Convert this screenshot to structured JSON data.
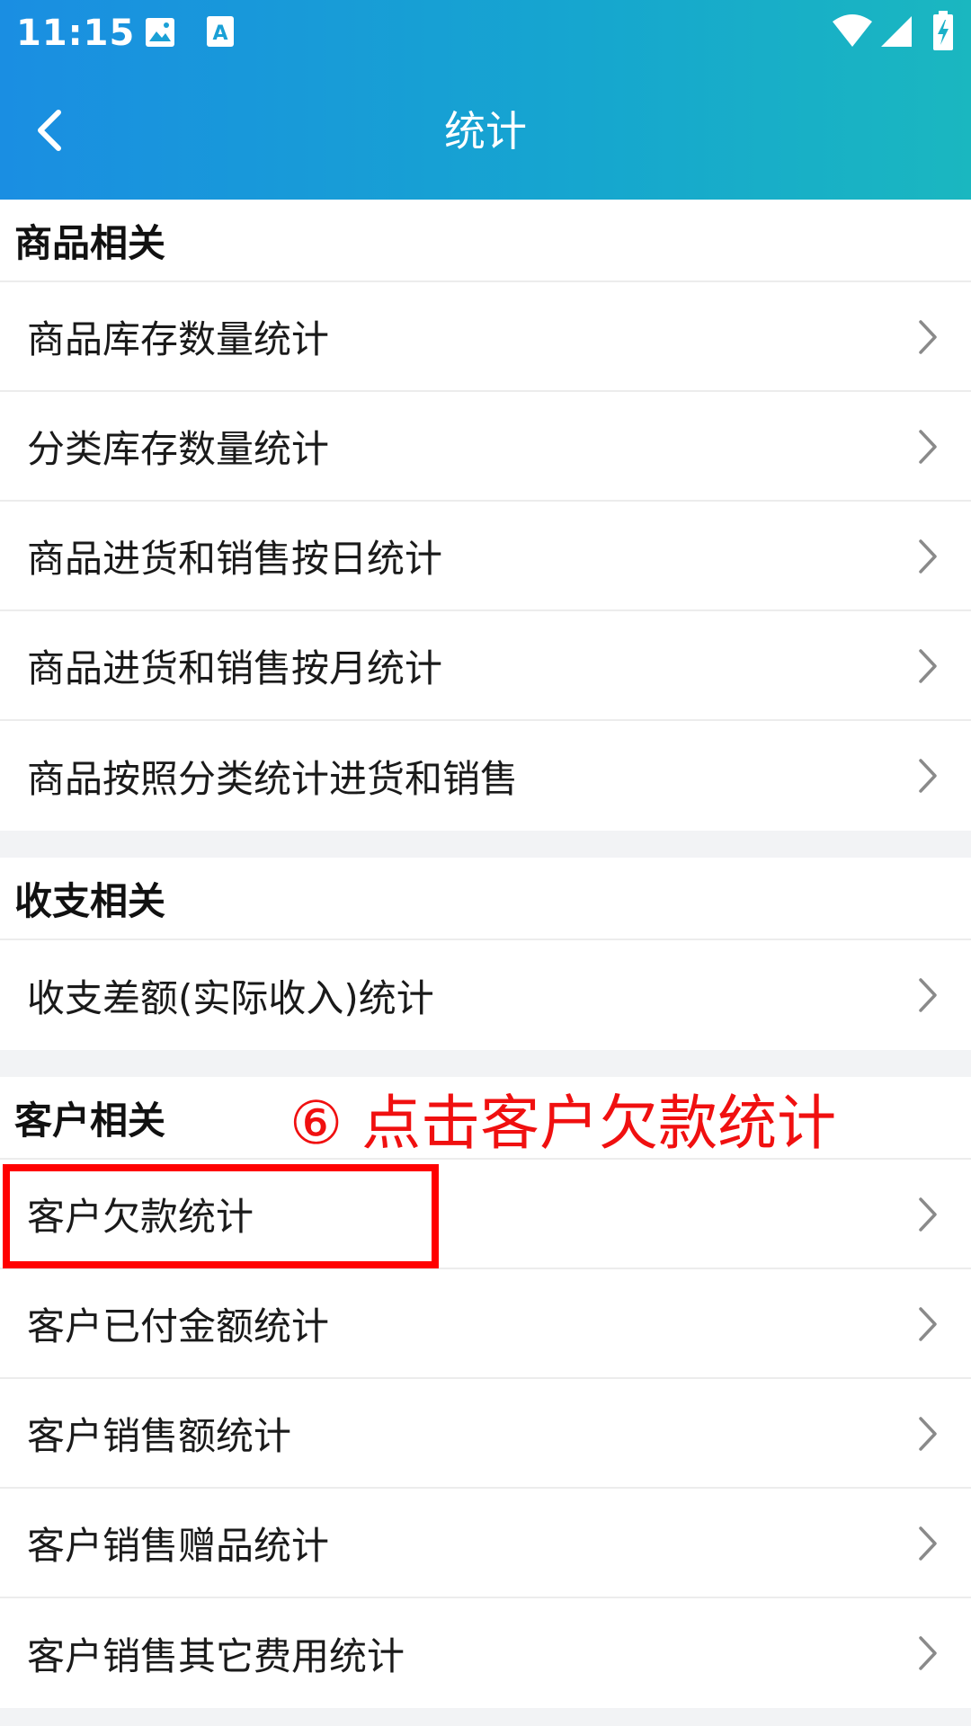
{
  "status_bar": {
    "time": "11:15",
    "icons": [
      "image-icon",
      "text-a-icon",
      "wifi-icon",
      "signal-icon",
      "battery-charging-icon"
    ]
  },
  "toolbar": {
    "title": "统计",
    "back_icon": "chevron-left-icon"
  },
  "colors": {
    "appbar_gradient_start": "#1a8ee2",
    "appbar_gradient_end": "#1ab7c0",
    "annotation": "#f01010",
    "highlight": "#ff0000"
  },
  "sections": [
    {
      "title": "商品相关",
      "items": [
        "商品库存数量统计",
        "分类库存数量统计",
        "商品进货和销售按日统计",
        "商品进货和销售按月统计",
        "商品按照分类统计进货和销售"
      ]
    },
    {
      "title": "收支相关",
      "items": [
        "收支差额(实际收入)统计"
      ]
    },
    {
      "title": "客户相关",
      "items": [
        "客户欠款统计",
        "客户已付金额统计",
        "客户销售额统计",
        "客户销售赠品统计",
        "客户销售其它费用统计"
      ]
    }
  ],
  "annotation": {
    "text": "⑥ 点击客户欠款统计"
  }
}
